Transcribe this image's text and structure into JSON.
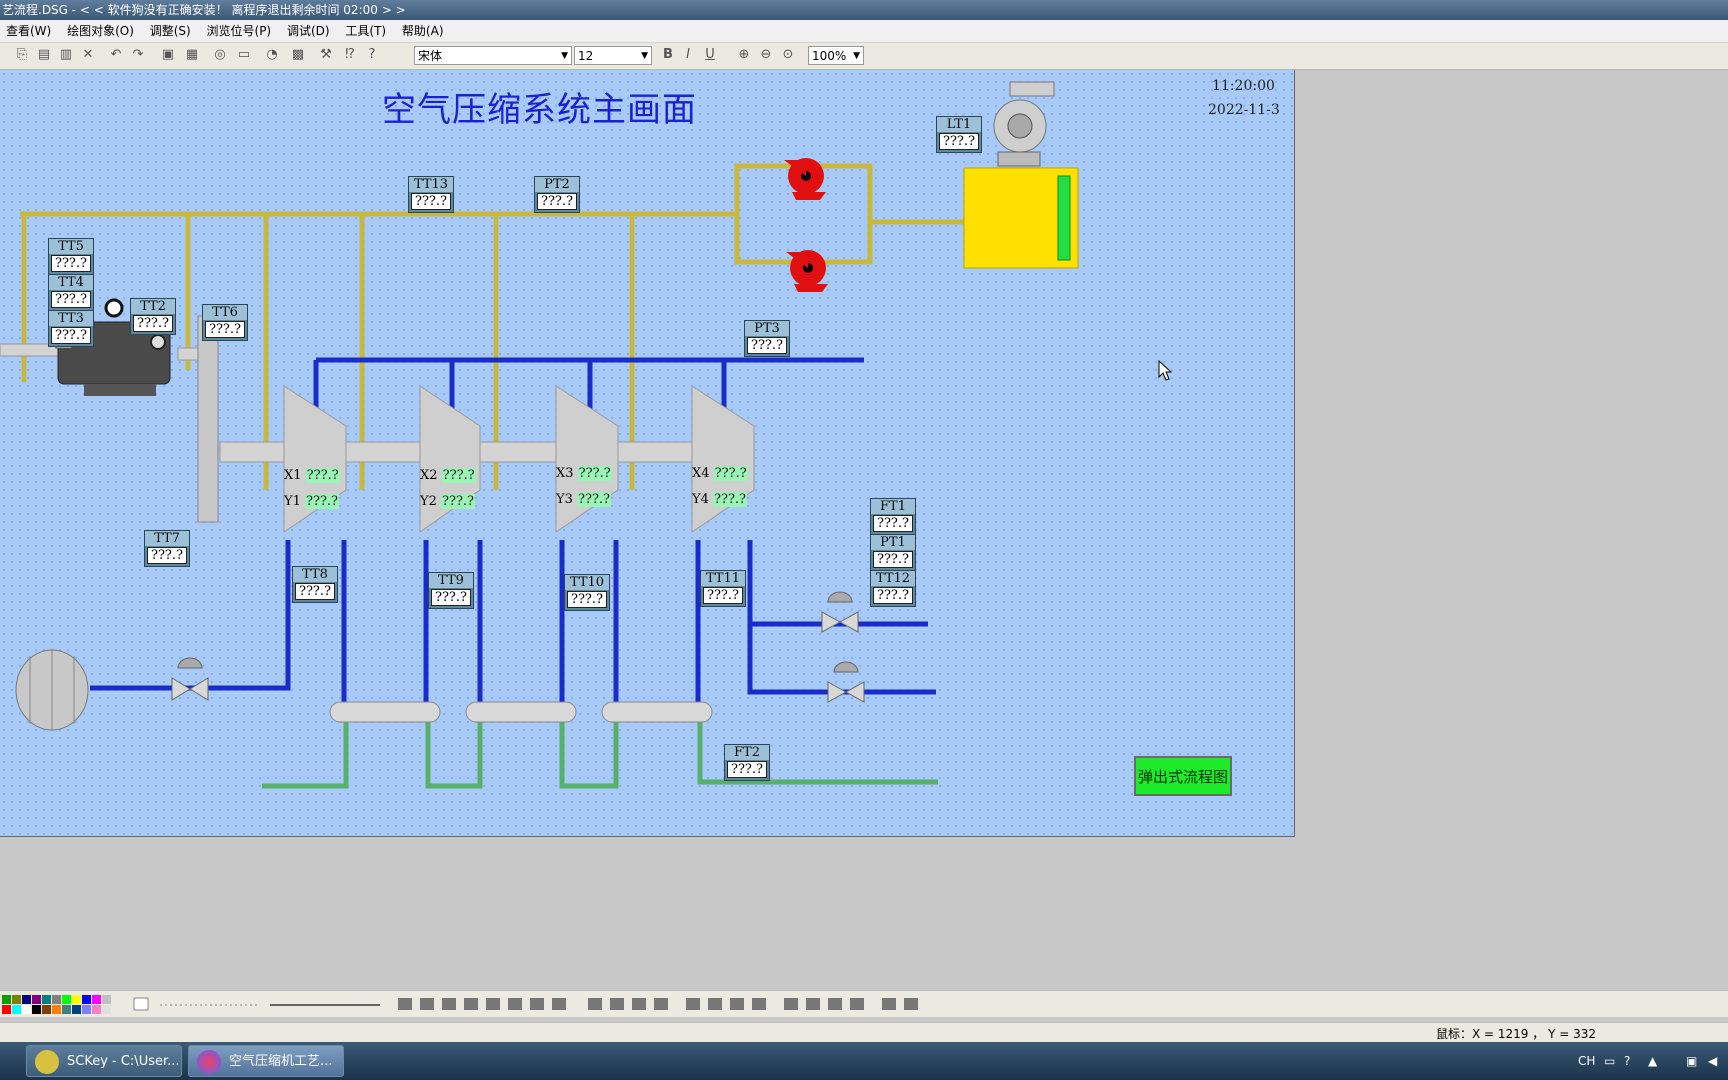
{
  "window": {
    "title": "艺流程.DSG - < < 软件狗没有正确安装！ 离程序退出剩余时间 02:00 > >"
  },
  "menu": [
    "查看(W)",
    "绘图对象(O)",
    "调整(S)",
    "浏览位号(P)",
    "调试(D)",
    "工具(T)",
    "帮助(A)"
  ],
  "toolbar": {
    "font": "宋体",
    "size": "12",
    "zoom": "100%"
  },
  "canvas": {
    "title": "空气压缩系统主画面",
    "time": "11:20:00",
    "date": "2022-11-3",
    "tags": [
      {
        "label": "LT1",
        "value": "???.?"
      },
      {
        "label": "TT13",
        "value": "???.?"
      },
      {
        "label": "PT2",
        "value": "???.?"
      },
      {
        "label": "TT5",
        "value": "???.?"
      },
      {
        "label": "TT4",
        "value": "???.?"
      },
      {
        "label": "TT3",
        "value": "???.?"
      },
      {
        "label": "TT2",
        "value": "???.?"
      },
      {
        "label": "TT6",
        "value": "???.?"
      },
      {
        "label": "PT3",
        "value": "???.?"
      },
      {
        "label": "TT7",
        "value": "???.?"
      },
      {
        "label": "TT8",
        "value": "???.?"
      },
      {
        "label": "TT9",
        "value": "???.?"
      },
      {
        "label": "TT10",
        "value": "???.?"
      },
      {
        "label": "TT11",
        "value": "???.?"
      },
      {
        "label": "FT1",
        "value": "???.?"
      },
      {
        "label": "PT1",
        "value": "???.?"
      },
      {
        "label": "TT12",
        "value": "???.?"
      },
      {
        "label": "FT2",
        "value": "???.?"
      }
    ],
    "compressors": [
      {
        "x": "X1",
        "y": "Y1",
        "xv": "???.?",
        "yv": "???.?"
      },
      {
        "x": "X2",
        "y": "Y2",
        "xv": "???.?",
        "yv": "???.?"
      },
      {
        "x": "X3",
        "y": "Y3",
        "xv": "???.?",
        "yv": "???.?"
      },
      {
        "x": "X4",
        "y": "Y4",
        "xv": "???.?",
        "yv": "???.?"
      }
    ],
    "popup_button": "弹出式流程图",
    "colors": {
      "background": "#a8caf8",
      "yellow_pipe": "#c8b83c",
      "blue_pipe": "#1a2cc8",
      "green_pipe": "#58b06a",
      "tank": "#ffe000",
      "level": "#22dd44",
      "pump": "#e01010"
    }
  },
  "status": {
    "coords": "鼠标：X = 1219 ， Y = 332"
  },
  "taskbar": {
    "tasks": [
      "SCKey - C:\\User...",
      "空气压缩机工艺..."
    ],
    "tray": "CH"
  }
}
